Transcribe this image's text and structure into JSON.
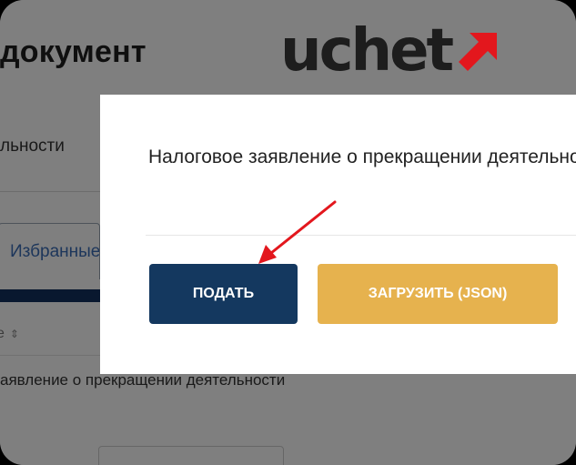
{
  "background": {
    "page_title": "документ",
    "activity_label": "льности",
    "tab_favorites": "Избранные",
    "sort_indicator": "е",
    "row_text": "аявление о прекращении деятельности"
  },
  "modal": {
    "title": "Налоговое заявление о прекращении деятельности",
    "submit_label": "ПОДАТЬ",
    "upload_label": "ЗАГРУЗИТЬ (JSON)"
  },
  "logo": {
    "text": "uchet",
    "arrow_color": "#e3171d"
  },
  "colors": {
    "primary": "#14385f",
    "accent": "#e6b24e",
    "annotation_arrow": "#e3171d"
  }
}
